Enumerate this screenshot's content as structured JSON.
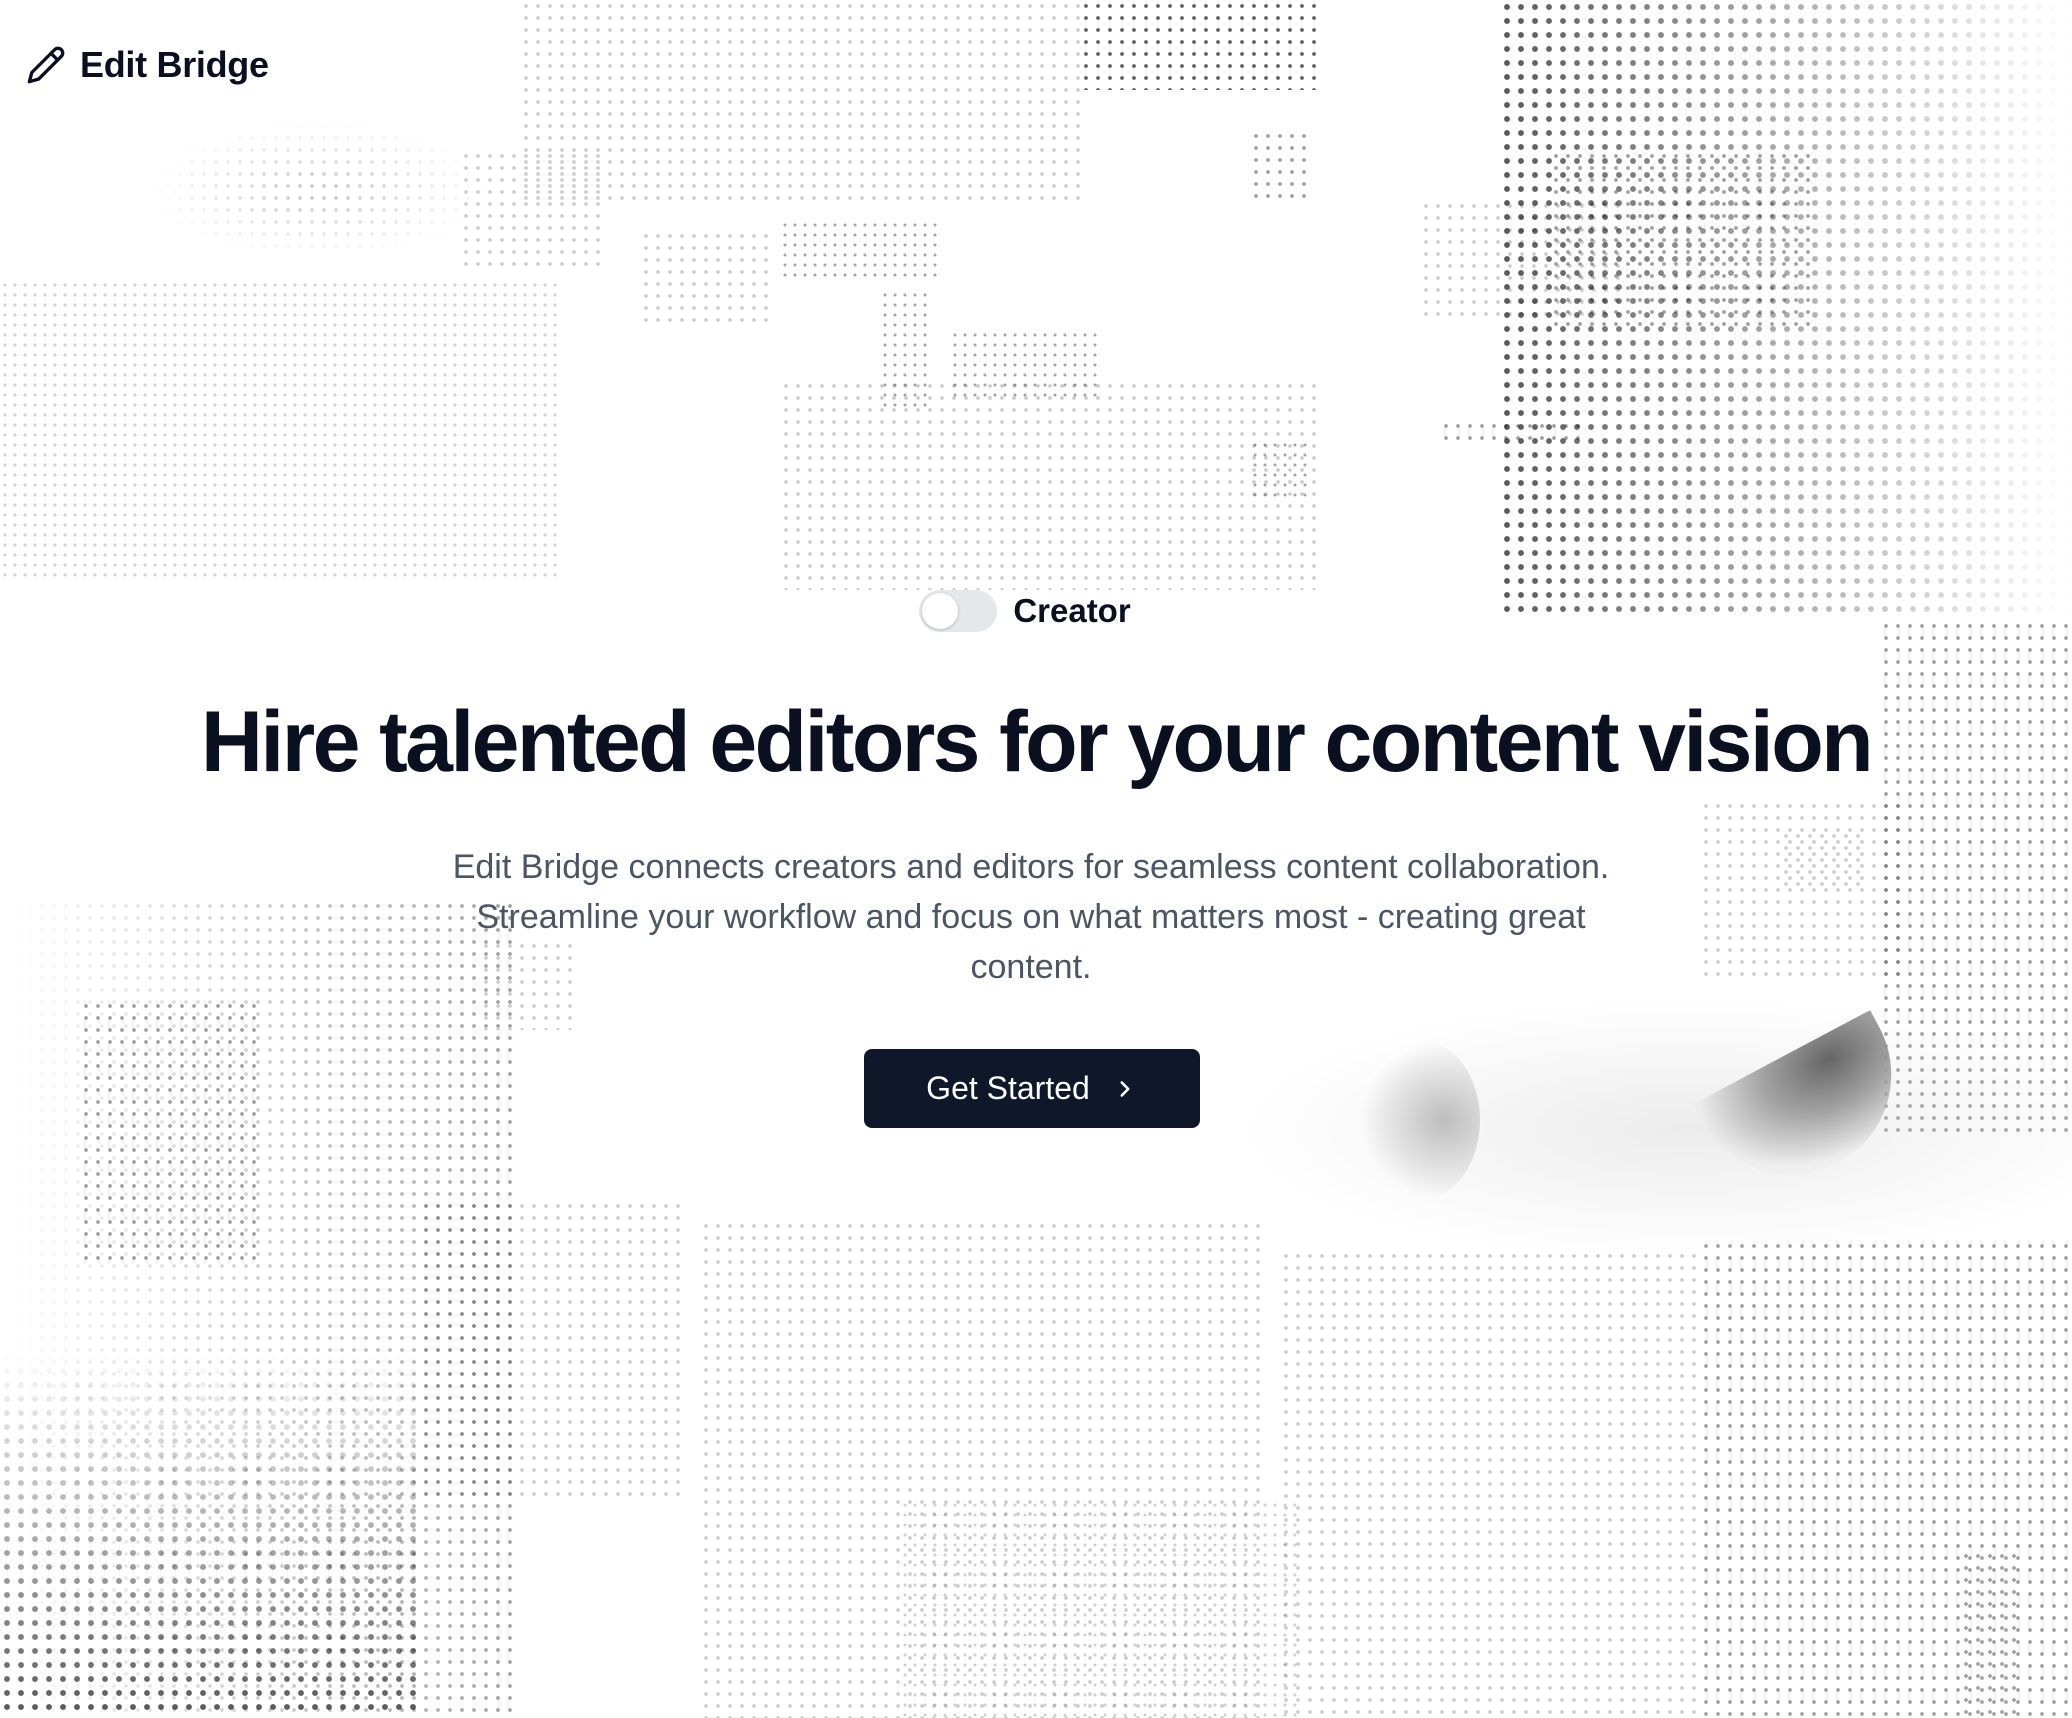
{
  "brand": {
    "name": "Edit Bridge",
    "icon": "pencil-icon"
  },
  "hero": {
    "toggle": {
      "label": "Creator",
      "state": "off"
    },
    "headline": "Hire talented editors for your content vision",
    "subtitle": "Edit Bridge connects creators and editors for seamless content collaboration. Streamline your workflow and focus on what matters most - creating great content.",
    "cta": {
      "label": "Get Started",
      "icon": "chevron-right-icon"
    }
  },
  "colors": {
    "text_primary": "#0b1020",
    "text_secondary": "#4b5563",
    "button_bg": "#0f172a",
    "toggle_track": "#e5e7eb",
    "background": "#ffffff"
  }
}
